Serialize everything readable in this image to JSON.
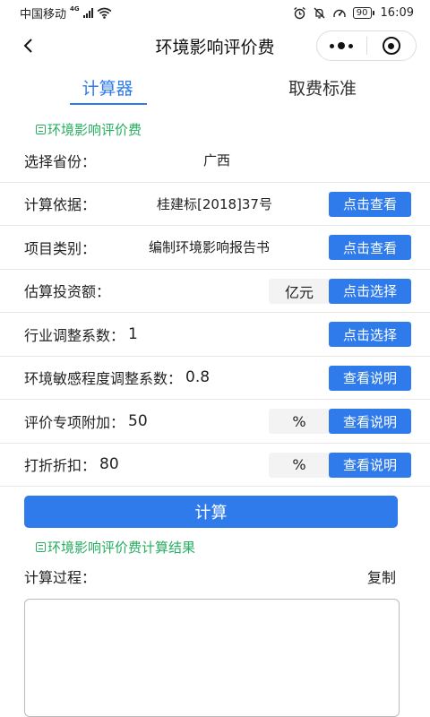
{
  "status_bar": {
    "carrier": "中国移动",
    "network": "4G",
    "battery": "90",
    "time": "16:09"
  },
  "nav": {
    "title": "环境影响评价费"
  },
  "tabs": [
    {
      "label": "计算器",
      "active": true
    },
    {
      "label": "取费标准",
      "active": false
    }
  ],
  "form_section_title": "环境影响评价费",
  "form": {
    "province": {
      "label": "选择省份：",
      "value": "广西"
    },
    "basis": {
      "label": "计算依据：",
      "value": "桂建标[2018]37号",
      "button": "点击查看"
    },
    "category": {
      "label": "项目类别：",
      "value": "编制环境影响报告书",
      "button": "点击查看"
    },
    "investment": {
      "label": "估算投资额：",
      "unit": "亿元",
      "button": "点击选择"
    },
    "industry": {
      "label": "行业调整系数：",
      "value": "1",
      "button": "点击选择"
    },
    "sensitivity": {
      "label": "环境敏感程度调整系数：",
      "value": "0.8",
      "button": "查看说明"
    },
    "special": {
      "label": "评价专项附加：",
      "value": "50",
      "unit": "%",
      "button": "查看说明"
    },
    "discount": {
      "label": "打折折扣：",
      "value": "80",
      "unit": "%",
      "button": "查看说明"
    }
  },
  "calculate_button": "计算",
  "result_section_title": "环境影响评价费计算结果",
  "result": {
    "process_label": "计算过程：",
    "copy_label": "复制",
    "process_text": ""
  },
  "colors": {
    "accent": "#2f7bec",
    "section_green": "#27ae60"
  }
}
